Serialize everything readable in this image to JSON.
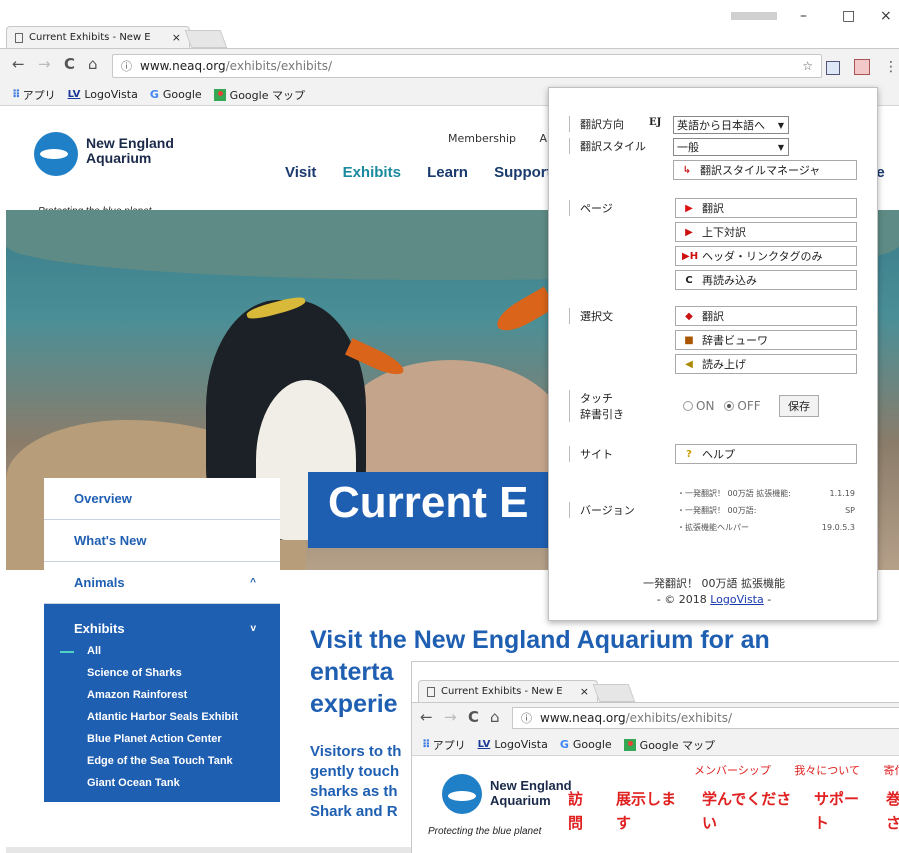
{
  "browser": {
    "tab_title": "Current Exhibits - New E",
    "tab_close": "×",
    "window_controls": {
      "minimize": "–",
      "maximize": "□",
      "close": "×"
    },
    "nav": {
      "back": "←",
      "forward": "→",
      "reload": "C",
      "home": "⌂"
    },
    "url_info": "ⓘ",
    "url_host": "www.neaq.org",
    "url_path": "/exhibits/exhibits/",
    "bookmark_star": "☆",
    "menu": "⋮",
    "bookmarks": [
      {
        "label": "アプリ",
        "icon": "apps-grid-icon"
      },
      {
        "label": "LogoVista",
        "icon": "lv-icon",
        "icon_text": "LV"
      },
      {
        "label": "Google",
        "icon": "google-icon",
        "icon_text": "G"
      },
      {
        "label": "Google マップ",
        "icon": "maps-icon"
      }
    ]
  },
  "site": {
    "logo_line1": "New England",
    "logo_line2": "Aquarium",
    "tagline": "Protecting the blue planet",
    "util_nav": [
      "Membership",
      "Ab"
    ],
    "main_nav": [
      "Visit",
      "Exhibits",
      "Learn",
      "Support"
    ],
    "main_nav_cut": "ce",
    "hero_title": "Current E",
    "sidenav": {
      "items": [
        {
          "label": "Overview"
        },
        {
          "label": "What's New"
        },
        {
          "label": "Animals",
          "chev": "^"
        }
      ],
      "open": {
        "label": "Exhibits",
        "chev": "v"
      },
      "sub": [
        "All",
        "Science of Sharks",
        "Amazon Rainforest",
        "Atlantic Harbor Seals Exhibit",
        "Blue Planet Action Center",
        "Edge of the Sea Touch Tank",
        "Giant Ocean Tank"
      ]
    },
    "headline": [
      "Visit the New England Aquarium for an",
      "enterta",
      "experie"
    ],
    "body": [
      "Visitors to th",
      "gently touch",
      "sharks as th",
      "Shark and R"
    ]
  },
  "popup": {
    "sections": {
      "direction": "翻訳方向",
      "style": "翻訳スタイル",
      "page": "ページ",
      "selection": "選択文",
      "touch": "タッチ\n辞書引き",
      "site": "サイト",
      "version": "バージョン"
    },
    "ej": "EJ",
    "direction_value": "英語から日本語へ",
    "style_value": "一般",
    "style_manager": "翻訳スタイルマネージャ",
    "page_buttons": [
      {
        "icon": "▶",
        "label": "翻訳"
      },
      {
        "icon": "▶",
        "label": "上下対訳"
      },
      {
        "icon": "▶H",
        "label": "ヘッダ・リンクタグのみ"
      },
      {
        "icon": "C",
        "label": "再読み込み"
      }
    ],
    "selection_buttons": [
      {
        "label": "翻訳"
      },
      {
        "label": "辞書ビューワ"
      },
      {
        "label": "読み上げ"
      }
    ],
    "touch_on": "ON",
    "touch_off": "OFF",
    "save": "保存",
    "help": "ヘルプ",
    "versions": [
      {
        "name": "・一発翻訳！ 00万語 拡張機能:",
        "value": "1.1.19"
      },
      {
        "name": "・一発翻訳！ 00万語:",
        "value": "SP"
      },
      {
        "name": "・拡張機能ヘルパー",
        "value": "19.0.5.3"
      }
    ],
    "footer_line1": "一発翻訳！ 00万語 拡張機能",
    "footer_pre": "- © 2018 ",
    "footer_link": "LogoVista",
    "footer_post": " -"
  },
  "window2": {
    "util_nav": [
      "メンバーシップ",
      "我々について",
      "寄付"
    ],
    "nav": [
      [
        "訪",
        "問"
      ],
      [
        "展示しま",
        "す"
      ],
      [
        "学んでくださ",
        "い"
      ],
      [
        "サポー",
        "ト"
      ],
      [
        "巻",
        "さ"
      ]
    ]
  }
}
